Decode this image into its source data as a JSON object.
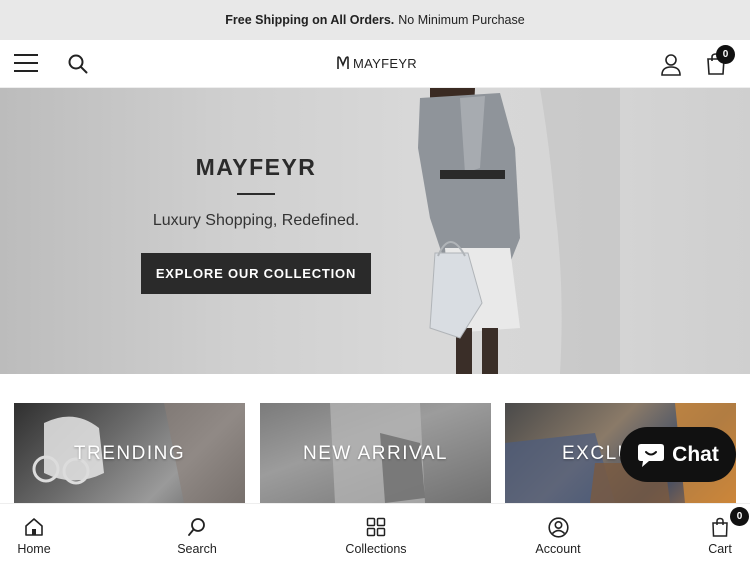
{
  "announcement": {
    "bold": "Free Shipping on All Orders.",
    "rest": "No Minimum Purchase"
  },
  "header": {
    "brand": "MAYFEYR",
    "cart_count": "0",
    "icons": [
      "menu-icon",
      "search-icon",
      "logo-m-icon",
      "user-icon",
      "shopping-bag-icon"
    ]
  },
  "hero": {
    "title": "MAYFEYR",
    "subtitle": "Luxury Shopping, Redefined.",
    "cta": "EXPLORE OUR COLLECTION"
  },
  "collections": [
    {
      "label": "TRENDING"
    },
    {
      "label": "NEW ARRIVAL"
    },
    {
      "label": "EXCLU"
    }
  ],
  "chat": {
    "label": "Chat",
    "icon": "chat-bubble-icon"
  },
  "bottom_nav": {
    "items": [
      {
        "label": "Home",
        "icon": "home-icon"
      },
      {
        "label": "Search",
        "icon": "search-icon"
      },
      {
        "label": "Collections",
        "icon": "grid-icon"
      },
      {
        "label": "Account",
        "icon": "account-circle-icon"
      },
      {
        "label": "Cart",
        "icon": "shopping-bag-icon"
      }
    ],
    "cart_count": "0"
  },
  "colors": {
    "announcement_bg": "#e8e8e8",
    "cta_bg": "#2a2a2a",
    "chat_bg": "#111111",
    "text": "#222222"
  }
}
